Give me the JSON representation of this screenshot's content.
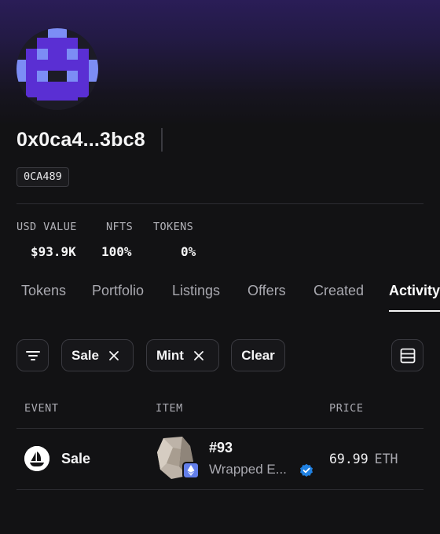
{
  "profile": {
    "address": "0x0ca4...3bc8",
    "badge": "0CA489"
  },
  "stats": {
    "usd_value_label": "USD VALUE",
    "usd_value": "$93.9K",
    "nfts_label": "NFTS",
    "nfts_value": "100%",
    "tokens_label": "TOKENS",
    "tokens_value": "0%"
  },
  "tabs": [
    {
      "label": "Tokens",
      "active": false
    },
    {
      "label": "Portfolio",
      "active": false
    },
    {
      "label": "Listings",
      "active": false
    },
    {
      "label": "Offers",
      "active": false
    },
    {
      "label": "Created",
      "active": false
    },
    {
      "label": "Activity",
      "active": true
    }
  ],
  "filters": {
    "chips": [
      "Sale",
      "Mint"
    ],
    "clear_label": "Clear",
    "icons": {
      "filter": "filter-icon",
      "remove": "close-icon",
      "view": "list-view-icon"
    }
  },
  "table": {
    "headers": [
      "EVENT",
      "ITEM",
      "PRICE"
    ],
    "rows": [
      {
        "event": "Sale",
        "event_icon": "opensea-boat-icon",
        "item_name": "#93",
        "item_collection": "Wrapped E...",
        "collection_verified": true,
        "price_value": "69.99",
        "price_unit": "ETH"
      }
    ]
  },
  "colors": {
    "background": "#121214",
    "header_glow": "#2a1d57",
    "avatar_purple": "#5b2fd6",
    "avatar_light": "#7b8cf5",
    "verified_blue": "#2081e2",
    "eth_blue": "#627eea"
  }
}
